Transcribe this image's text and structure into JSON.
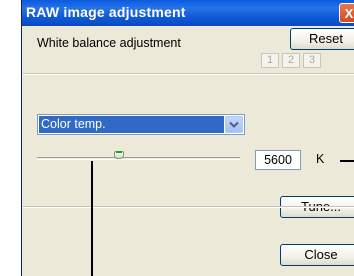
{
  "window": {
    "title": "RAW image adjustment",
    "close_icon": "close-icon",
    "close_glyph": "X"
  },
  "white_balance": {
    "label": "White balance adjustment",
    "reset_label": "Reset",
    "presets": [
      "1",
      "2",
      "3"
    ]
  },
  "mode_select": {
    "selected": "Color temp.",
    "arrow_icon": "chevron-down-icon"
  },
  "color_temp": {
    "slider_level": 0.4,
    "value": "5600",
    "unit": "K"
  },
  "buttons": {
    "tune_label": "Tune...",
    "close_label": "Close"
  },
  "colors": {
    "titlebar": "#0a5ae0",
    "face": "#ece9d8",
    "selection": "#316ac5",
    "close_button": "#d24a22"
  }
}
